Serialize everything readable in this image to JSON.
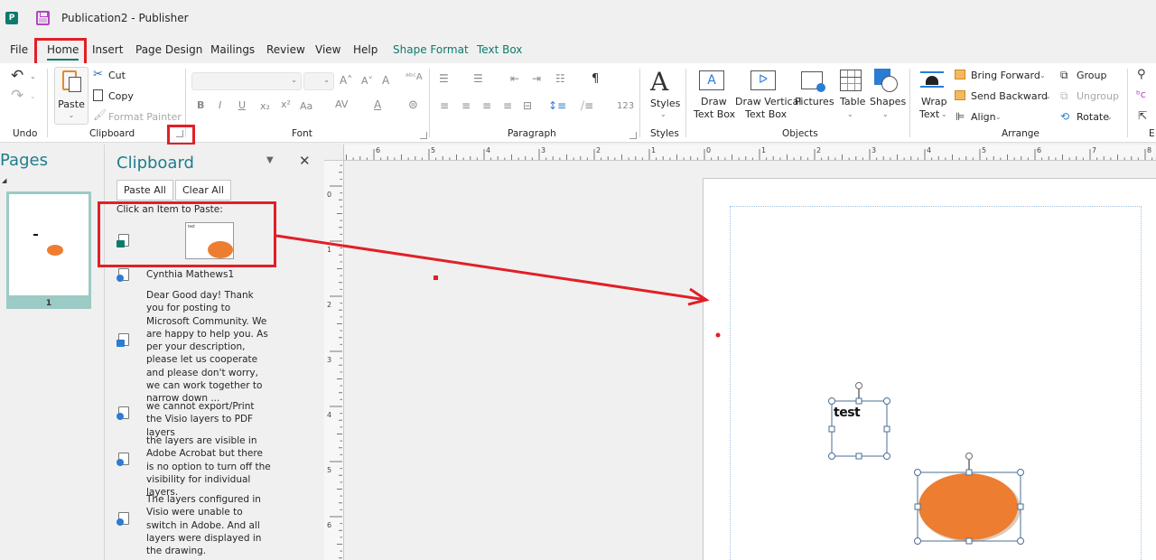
{
  "window": {
    "title": "Publication2 - Publisher",
    "app_icon": "publisher-icon",
    "save_icon": "save-icon"
  },
  "tabs": [
    {
      "label": "File",
      "active": false,
      "contextual": false
    },
    {
      "label": "Home",
      "active": true,
      "contextual": false
    },
    {
      "label": "Insert",
      "active": false,
      "contextual": false
    },
    {
      "label": "Page Design",
      "active": false,
      "contextual": false
    },
    {
      "label": "Mailings",
      "active": false,
      "contextual": false
    },
    {
      "label": "Review",
      "active": false,
      "contextual": false
    },
    {
      "label": "View",
      "active": false,
      "contextual": false
    },
    {
      "label": "Help",
      "active": false,
      "contextual": false
    },
    {
      "label": "Shape Format",
      "active": false,
      "contextual": true
    },
    {
      "label": "Text Box",
      "active": false,
      "contextual": true
    }
  ],
  "ribbon": {
    "undo": {
      "label": "Undo"
    },
    "clipboard": {
      "label": "Clipboard",
      "paste": "Paste",
      "cut": "Cut",
      "copy": "Copy",
      "format_painter": "Format Painter"
    },
    "font": {
      "label": "Font",
      "font_name_value": "",
      "font_size_value": "",
      "bold": "B",
      "italic": "I",
      "underline": "U",
      "subscript": "x₂",
      "superscript": "x²",
      "change_case": "Aa",
      "char_spacing": "AV",
      "font_color": "A"
    },
    "paragraph": {
      "label": "Paragraph",
      "show_marks": "¶",
      "numbering": "123"
    },
    "styles": {
      "label": "Styles",
      "button": "Styles"
    },
    "objects": {
      "label": "Objects",
      "draw_text_box": [
        "Draw",
        "Text Box"
      ],
      "draw_vertical_text_box": [
        "Draw Vertical",
        "Text Box"
      ],
      "pictures": "Pictures",
      "table": "Table",
      "shapes": "Shapes"
    },
    "arrange": {
      "label": "Arrange",
      "wrap_text": [
        "Wrap",
        "Text"
      ],
      "bring_forward": "Bring Forward",
      "send_backward": "Send Backward",
      "align": "Align",
      "group": "Group",
      "ungroup": "Ungroup",
      "rotate": "Rotate"
    },
    "editing": {
      "label": "E"
    }
  },
  "pages_pane": {
    "title": "Pages",
    "pages": [
      {
        "number": "1"
      }
    ]
  },
  "clipboard_pane": {
    "title": "Clipboard",
    "paste_all": "Paste All",
    "clear_all": "Clear All",
    "instruction": "Click an Item to Paste:",
    "items": [
      {
        "type": "publisher",
        "icon": "publisher-clip-icon",
        "preview_text": "test",
        "kind": "image-preview"
      },
      {
        "type": "web",
        "icon": "web-doc-icon",
        "text": "Cynthia Mathews1"
      },
      {
        "type": "word",
        "icon": "word-doc-icon",
        "text": "Dear Good day! Thank you for posting to Microsoft Community. We are happy to help you. As per your description, please let us cooperate and please don't worry, we can work together to narrow down ..."
      },
      {
        "type": "web",
        "icon": "web-doc-icon",
        "text": "we cannot export/Print the Visio layers to PDF layers"
      },
      {
        "type": "web",
        "icon": "web-doc-icon",
        "text": "the layers are visible in Adobe Acrobat but there is no option to turn off the visibility for individual layers."
      },
      {
        "type": "web",
        "icon": "web-doc-icon",
        "text": "The layers configured in Visio were unable to switch in Adobe. And all layers were displayed in the drawing."
      }
    ]
  },
  "rulers": {
    "horizontal_labels": [
      "6",
      "5",
      "4",
      "3",
      "2",
      "1",
      "0",
      "1",
      "2",
      "3",
      "4",
      "5",
      "6",
      "7",
      "8"
    ],
    "vertical_labels": [
      "0",
      "1",
      "2",
      "3",
      "4",
      "5",
      "6"
    ]
  },
  "canvas": {
    "text_box": {
      "text": "test"
    },
    "oval": {
      "fill": "#ED7D31"
    }
  },
  "colors": {
    "accent": "#0E7A6D",
    "pane_title": "#1F7D8C",
    "annotation_red": "#E21F26",
    "shape_orange": "#ED7D31",
    "selection_handle": "#4A6F96"
  }
}
